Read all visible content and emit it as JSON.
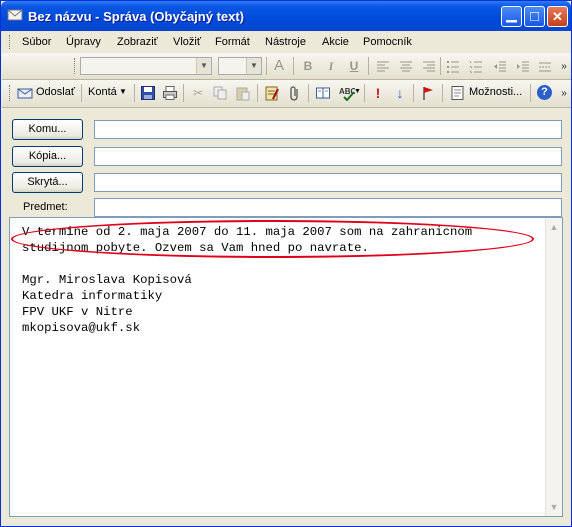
{
  "window": {
    "title": "Bez názvu - Správa (Obyčajný text)",
    "minimize_glyph": "▁",
    "maximize_glyph": "□",
    "close_glyph": "✕"
  },
  "menu": {
    "items": [
      "Súbor",
      "Úpravy",
      "Zobraziť",
      "Vložiť",
      "Formát",
      "Nástroje",
      "Akcie",
      "Pomocník"
    ]
  },
  "format_toolbar": {
    "font_name": "",
    "font_size": "",
    "font_color_glyph": "A",
    "bold_glyph": "B",
    "italic_glyph": "I",
    "underline_glyph": "U",
    "more_glyph": "»"
  },
  "standard_toolbar": {
    "send_label": "Odoslať",
    "accounts_label": "Kontá",
    "options_label": "Možnosti...",
    "help_glyph": "?",
    "more_glyph": "»",
    "importance_glyph": "!",
    "down_glyph": "↓"
  },
  "header": {
    "to_button": "Komu...",
    "cc_button": "Kópia...",
    "bcc_button": "Skrytá...",
    "subject_label": "Predmet:",
    "to_value": "",
    "cc_value": "",
    "bcc_value": "",
    "subject_value": ""
  },
  "body": {
    "line1": "V termine od 2. maja 2007 do 11. maja 2007 som na zahranicnom",
    "line2": "studijnom pobyte. Ozvem sa Vam hned po navrate.",
    "line3": "",
    "line4": "Mgr. Miroslava Kopisová",
    "line5": "Katedra informatiky",
    "line6": "FPV UKF v Nitre",
    "line7": "mkopisova@ukf.sk"
  },
  "colors": {
    "titlebar": "#0A57E3",
    "highlight_oval": "#E0001A",
    "window_bg": "#ECE9D8"
  }
}
